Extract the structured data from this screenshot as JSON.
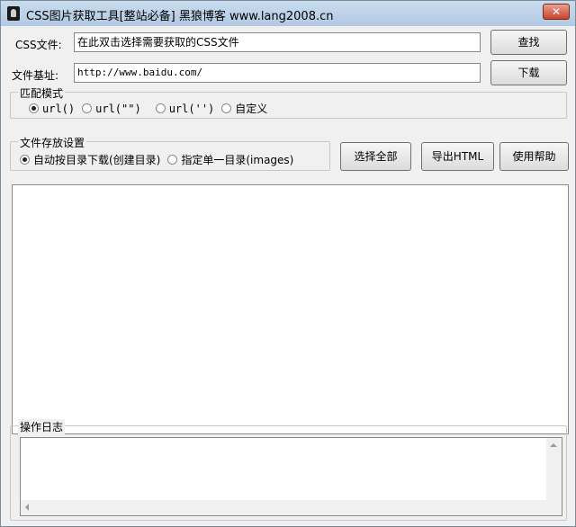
{
  "window": {
    "title": "CSS图片获取工具[整站必备]  黑狼博客 www.lang2008.cn",
    "close_label": "✕"
  },
  "css_file": {
    "label": "CSS文件:",
    "value": "在此双击选择需要获取的CSS文件",
    "browse_label": "查找"
  },
  "base_url": {
    "label": "文件基址:",
    "value": "http://www.baidu.com/",
    "download_label": "下载"
  },
  "match_mode": {
    "legend": "匹配模式",
    "options": [
      {
        "label": "url()",
        "checked": true
      },
      {
        "label": "url(\"\")",
        "checked": false
      },
      {
        "label": "url('')",
        "checked": false
      },
      {
        "label": "自定义",
        "checked": false
      }
    ]
  },
  "storage": {
    "legend": "文件存放设置",
    "options": [
      {
        "label": "自动按目录下载(创建目录)",
        "checked": true
      },
      {
        "label": "指定单一目录(images)",
        "checked": false
      }
    ]
  },
  "actions": {
    "select_all": "选择全部",
    "export_html": "导出HTML",
    "help": "使用帮助"
  },
  "log": {
    "legend": "操作日志"
  },
  "icons": {
    "app": "app-icon",
    "close": "close-icon"
  }
}
